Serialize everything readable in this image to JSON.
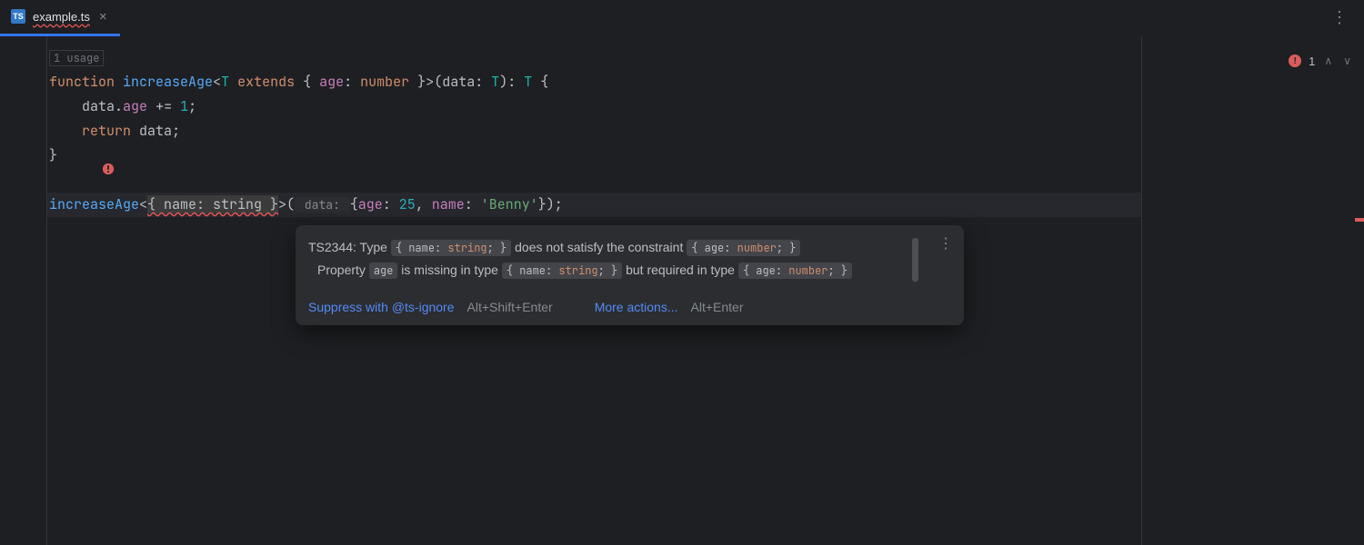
{
  "tab": {
    "icon_label": "TS",
    "filename": "example.ts"
  },
  "editor": {
    "usage_hint": "1 usage",
    "code": {
      "l1": {
        "function": "function",
        "name": "increaseAge",
        "lt": "<",
        "tparam": "T",
        "extends": "extends",
        "obrace": "{ ",
        "prop": "age",
        "colon": ": ",
        "ptype": "number",
        "cbrace": " }",
        "gt": ">(",
        "param": "data",
        "colon2": ": ",
        "ptype2": "T",
        "rp": "): ",
        "ret": "T",
        "ob": " {"
      },
      "l2": {
        "indent": "    ",
        "obj": "data",
        "dot": ".",
        "prop": "age",
        "op": " += ",
        "num": "1",
        "semi": ";"
      },
      "l3": {
        "indent": "    ",
        "ret": "return",
        "sp": " ",
        "obj": "data",
        "semi": ";"
      },
      "l4": {
        "brace": "}"
      },
      "l6": {
        "fn": "increaseAge",
        "lt": "<",
        "err": "{ name: string }",
        "gt": ">(",
        "hint": " data: ",
        "obrace": "{",
        "p1": "age",
        "c1": ": ",
        "v1": "25",
        "comma": ", ",
        "p2": "name",
        "c2": ": ",
        "v2": "'Benny'",
        "cbrace": "});"
      }
    }
  },
  "inspection": {
    "error_count": "1"
  },
  "tooltip": {
    "prefix": "TS2344: Type ",
    "chip1_a": "{ name: ",
    "chip1_b": "string",
    "chip1_c": "; }",
    "mid1": " does not satisfy the constraint ",
    "chip2_a": "{ age: ",
    "chip2_b": "number",
    "chip2_c": "; }",
    "line2_a": "Property ",
    "chip3": "age",
    "line2_b": " is missing in type ",
    "chip4_a": "{ name: ",
    "chip4_b": "string",
    "chip4_c": "; }",
    "line2_c": " but required in type ",
    "chip5_a": "{ age: ",
    "chip5_b": "number",
    "chip5_c": "; }",
    "action1_label": "Suppress with @ts-ignore",
    "action1_shortcut": "Alt+Shift+Enter",
    "action2_label": "More actions...",
    "action2_shortcut": "Alt+Enter"
  }
}
